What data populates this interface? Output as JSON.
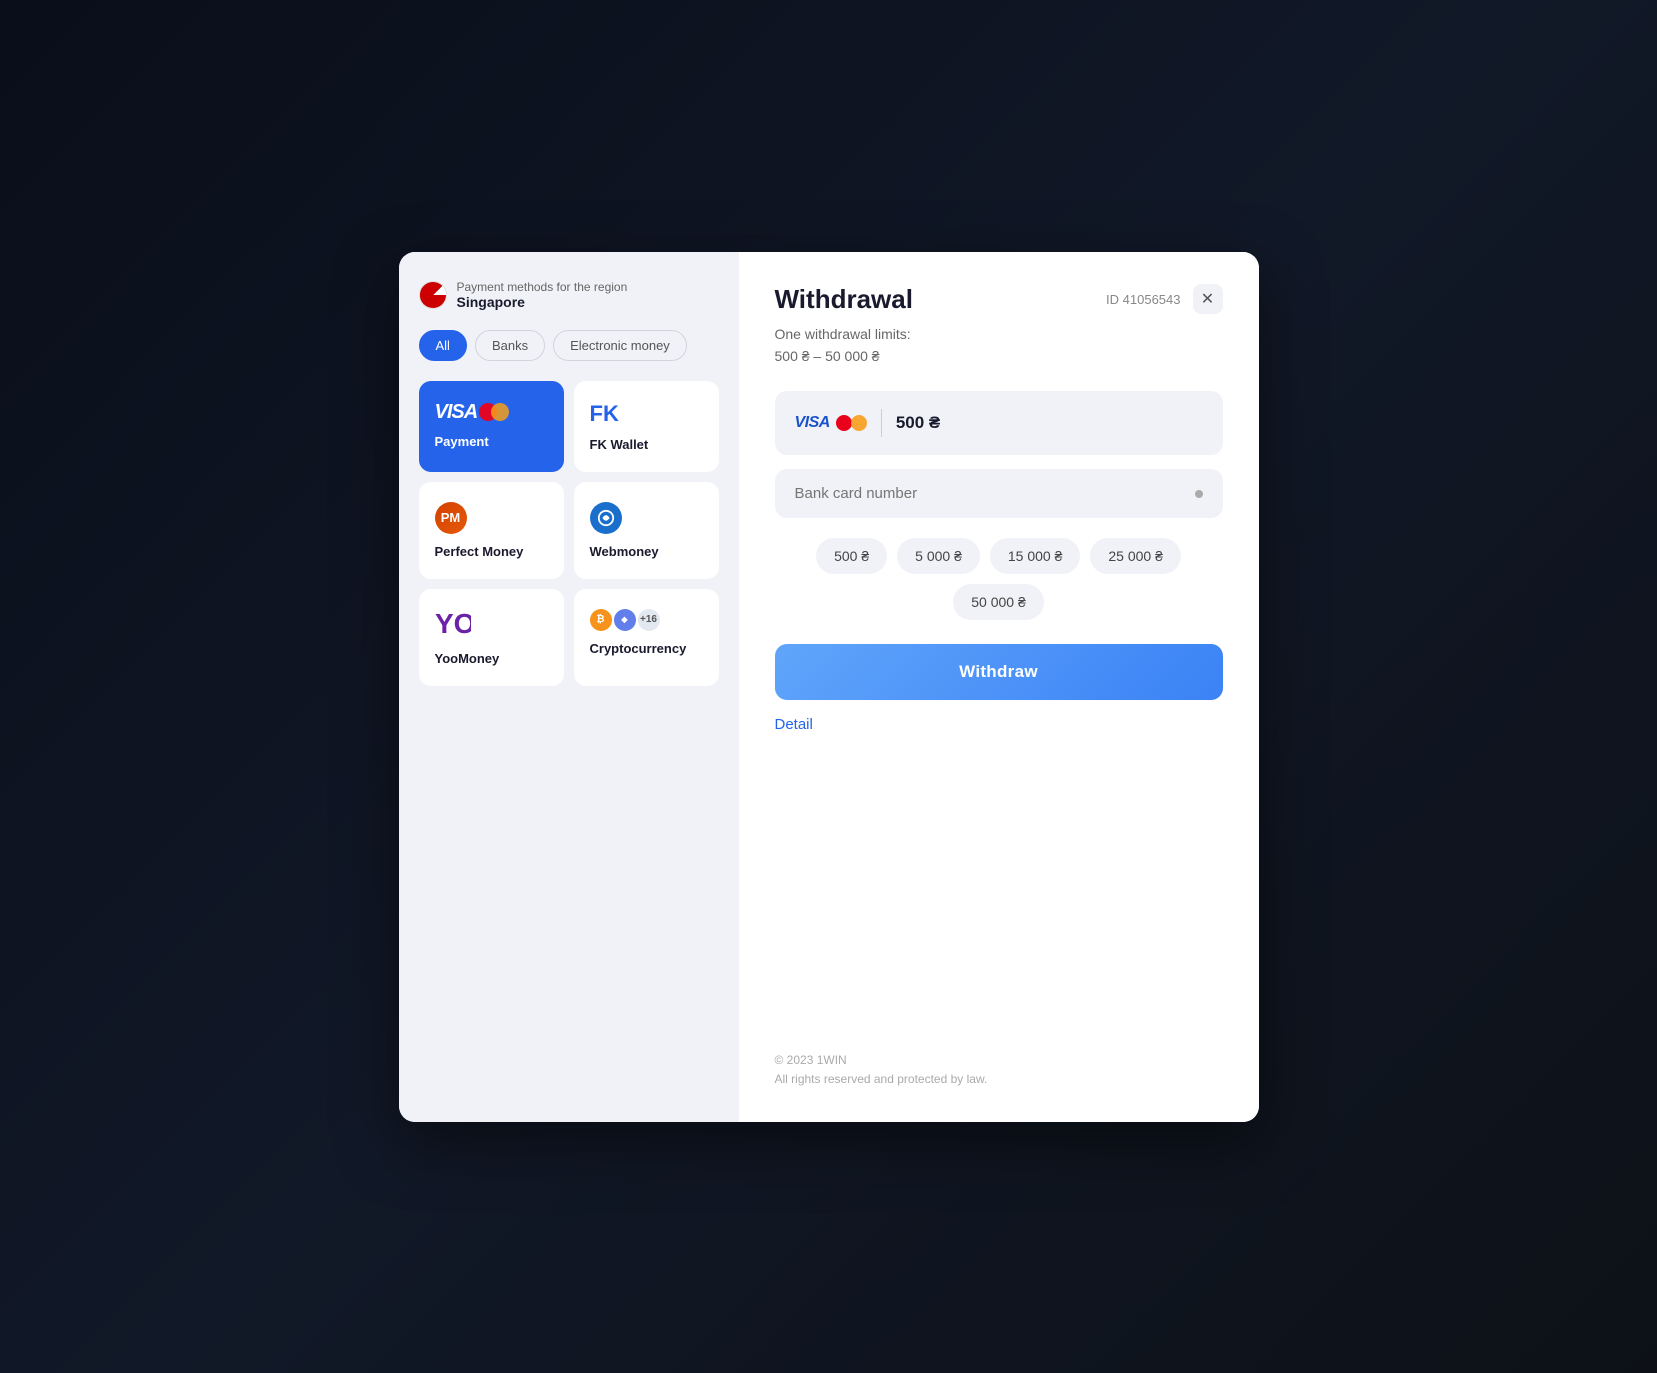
{
  "modal": {
    "left": {
      "region_label": "Payment methods for the region",
      "region_name": "Singapore",
      "filters": [
        {
          "id": "all",
          "label": "All",
          "active": true
        },
        {
          "id": "banks",
          "label": "Banks",
          "active": false
        },
        {
          "id": "electronic",
          "label": "Electronic money",
          "active": false
        }
      ],
      "payment_methods": [
        {
          "id": "visa",
          "label": "Payment",
          "type": "visa",
          "active": true
        },
        {
          "id": "fk",
          "label": "FK Wallet",
          "type": "fk",
          "active": false
        },
        {
          "id": "pm",
          "label": "Perfect Money",
          "type": "pm",
          "active": false
        },
        {
          "id": "wm",
          "label": "Webmoney",
          "type": "wm",
          "active": false
        },
        {
          "id": "yoo",
          "label": "YooMoney",
          "type": "yoo",
          "active": false
        },
        {
          "id": "crypto",
          "label": "Cryptocurrency",
          "type": "crypto",
          "active": false
        }
      ]
    },
    "right": {
      "title": "Withdrawal",
      "id_label": "ID 41056543",
      "limits_line1": "One withdrawal limits:",
      "limits_line2": "500 ₴ – 50 000 ₴",
      "amount": "500 ₴",
      "card_placeholder": "Bank card number",
      "chips": [
        "500 ₴",
        "5 000 ₴",
        "15 000 ₴",
        "25 000 ₴",
        "50 000 ₴"
      ],
      "withdraw_btn": "Withdraw",
      "detail_link": "Detail",
      "footer_line1": "© 2023 1WIN",
      "footer_line2": "All rights reserved and protected by law."
    }
  }
}
